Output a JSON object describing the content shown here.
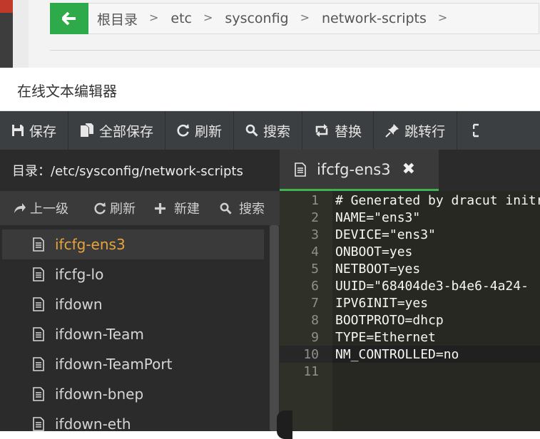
{
  "breadcrumb": {
    "back_label": "←",
    "items": [
      "根目录",
      "etc",
      "sysconfig",
      "network-scripts"
    ],
    "separator": ">"
  },
  "editor": {
    "title": "在线文本编辑器",
    "toolbar": [
      {
        "icon": "save-icon",
        "label": "保存"
      },
      {
        "icon": "save-all-icon",
        "label": "全部保存"
      },
      {
        "icon": "refresh-icon",
        "label": "刷新"
      },
      {
        "icon": "search-icon",
        "label": "搜索"
      },
      {
        "icon": "replace-icon",
        "label": "替换"
      },
      {
        "icon": "goto-line-icon",
        "label": "跳转行"
      }
    ]
  },
  "file_panel": {
    "directory_label": "目录：/etc/sysconfig/network-scripts",
    "actions": [
      {
        "icon": "up-arrow-icon",
        "label": "上一级"
      },
      {
        "icon": "refresh-icon",
        "label": "刷新"
      },
      {
        "icon": "plus-icon",
        "label": "新建"
      },
      {
        "icon": "search-icon",
        "label": "搜索"
      }
    ],
    "files": [
      {
        "name": "ifcfg-ens3",
        "active": true
      },
      {
        "name": "ifcfg-lo",
        "active": false
      },
      {
        "name": "ifdown",
        "active": false
      },
      {
        "name": "ifdown-Team",
        "active": false
      },
      {
        "name": "ifdown-TeamPort",
        "active": false
      },
      {
        "name": "ifdown-bnep",
        "active": false
      },
      {
        "name": "ifdown-eth",
        "active": false
      }
    ]
  },
  "tab": {
    "filename": "ifcfg-ens3",
    "close_symbol": "✖"
  },
  "code": {
    "line_numbers": [
      "1",
      "2",
      "3",
      "4",
      "5",
      "6",
      "7",
      "8",
      "9",
      "10",
      "11"
    ],
    "lines": [
      "# Generated by dracut initrd",
      "NAME=\"ens3\"",
      "DEVICE=\"ens3\"",
      "ONBOOT=yes",
      "NETBOOT=yes",
      "UUID=\"68404de3-b4e6-4a24-",
      "IPV6INIT=yes",
      "BOOTPROTO=dhcp",
      "TYPE=Ethernet",
      "NM_CONTROLLED=no",
      ""
    ]
  },
  "colors": {
    "accent_green": "#2faa4a",
    "active_file": "#e8a33a",
    "toolbar_bg": "#3c3f41",
    "code_bg": "#272822"
  }
}
